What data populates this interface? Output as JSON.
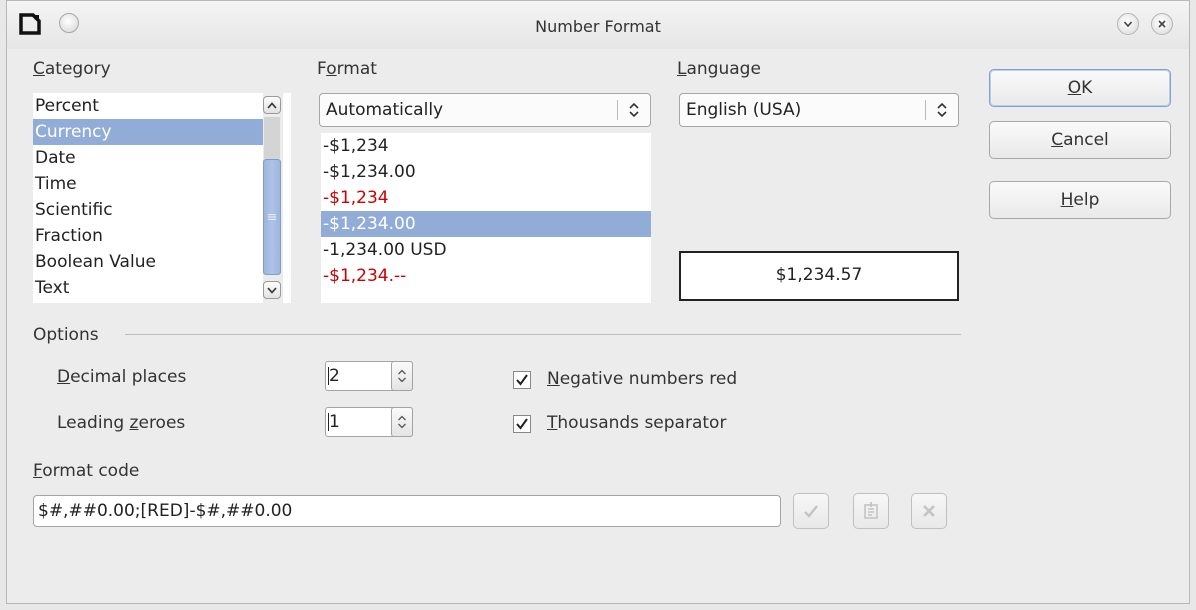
{
  "window": {
    "title": "Number Format",
    "icons": [
      "document-icon",
      "menu-dot-icon",
      "minimize-chevron-icon",
      "close-icon"
    ]
  },
  "category": {
    "label_mnemonic": "C",
    "label_rest": "ategory",
    "items": [
      "Percent",
      "Currency",
      "Date",
      "Time",
      "Scientific",
      "Fraction",
      "Boolean Value",
      "Text"
    ],
    "selected": "Currency"
  },
  "format": {
    "label_pre": "F",
    "label_mnemonic": "o",
    "label_rest": "rmat",
    "combo_value": "Automatically",
    "items": [
      {
        "text": "-$1,234",
        "negative_red": false
      },
      {
        "text": "-$1,234.00",
        "negative_red": false
      },
      {
        "text": "-$1,234",
        "negative_red": true
      },
      {
        "text": "-$1,234.00",
        "negative_red": true,
        "selected": true
      },
      {
        "text": "-1,234.00 USD",
        "negative_red": false
      },
      {
        "text": "-$1,234.--",
        "negative_red": true
      }
    ]
  },
  "language": {
    "label_mnemonic": "L",
    "label_rest": "anguage",
    "combo_value": "English (USA)"
  },
  "preview": {
    "value": "$1,234.57"
  },
  "buttons": {
    "ok_mnemonic": "O",
    "ok_rest": "K",
    "cancel_mnemonic": "C",
    "cancel_rest": "ancel",
    "help_mnemonic": "H",
    "help_rest": "elp"
  },
  "options": {
    "heading": "Options",
    "decimal_mnemonic": "D",
    "decimal_rest": "ecimal places",
    "decimal_value": "2",
    "leading_pre": "Leading ",
    "leading_mnemonic": "z",
    "leading_rest": "eroes",
    "leading_value": "1",
    "negative_red_mnemonic": "N",
    "negative_red_rest": "egative numbers red",
    "negative_red_checked": true,
    "thousands_mnemonic": "T",
    "thousands_rest": "housands separator",
    "thousands_checked": true
  },
  "format_code": {
    "label_mnemonic": "F",
    "label_rest": "ormat code",
    "value": "$#,##0.00;[RED]-$#,##0.00"
  },
  "colors": {
    "selection": "#91acd7",
    "negative_red": "#cc0000",
    "default_button_border": "#7e9fd3"
  }
}
